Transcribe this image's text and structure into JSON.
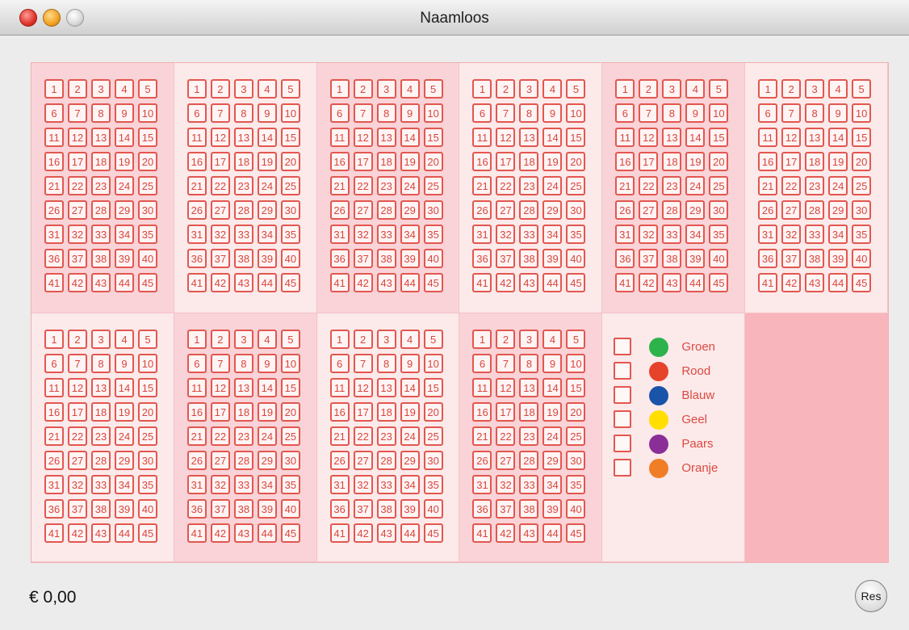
{
  "window": {
    "title": "Naamloos"
  },
  "numbers": [
    "1",
    "2",
    "3",
    "4",
    "5",
    "6",
    "7",
    "8",
    "9",
    "10",
    "11",
    "12",
    "13",
    "14",
    "15",
    "16",
    "17",
    "18",
    "19",
    "20",
    "21",
    "22",
    "23",
    "24",
    "25",
    "26",
    "27",
    "28",
    "29",
    "30",
    "31",
    "32",
    "33",
    "34",
    "35",
    "36",
    "37",
    "38",
    "39",
    "40",
    "41",
    "42",
    "43",
    "44",
    "45"
  ],
  "panels": [
    "dark",
    "light",
    "dark",
    "light",
    "dark",
    "light",
    "light",
    "dark",
    "light",
    "dark"
  ],
  "colors": [
    {
      "name": "Groen",
      "color": "#2db34a"
    },
    {
      "name": "Rood",
      "color": "#e5432a"
    },
    {
      "name": "Blauw",
      "color": "#1a54a9"
    },
    {
      "name": "Geel",
      "color": "#ffde00"
    },
    {
      "name": "Paars",
      "color": "#8a2f97"
    },
    {
      "name": "Oranje",
      "color": "#f07e26"
    }
  ],
  "footer": {
    "amount": "€ 0,00",
    "button_label": "Res"
  }
}
